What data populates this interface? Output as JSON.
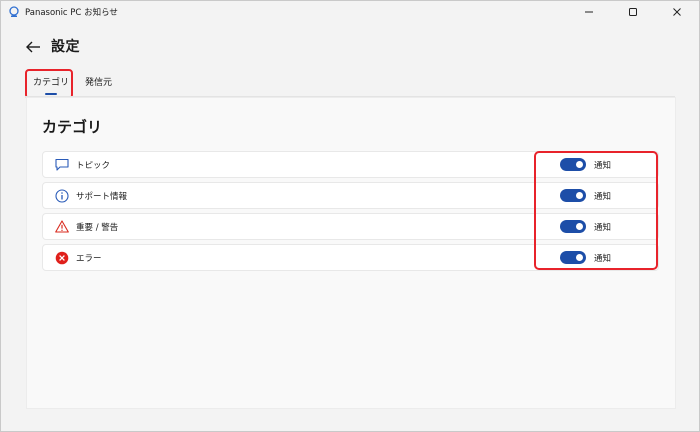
{
  "window": {
    "title": "Panasonic PC お知らせ"
  },
  "header": {
    "title": "設定"
  },
  "tabs": [
    {
      "label": "カテゴリ",
      "active": true
    },
    {
      "label": "発信元",
      "active": false
    }
  ],
  "section": {
    "title": "カテゴリ"
  },
  "categories": [
    {
      "label": "トピック",
      "icon": "chat-bubble-icon",
      "toggle_label": "通知",
      "enabled": true
    },
    {
      "label": "サポート情報",
      "icon": "info-icon",
      "toggle_label": "通知",
      "enabled": true
    },
    {
      "label": "重要 / 警告",
      "icon": "warning-icon",
      "toggle_label": "通知",
      "enabled": true
    },
    {
      "label": "エラー",
      "icon": "error-icon",
      "toggle_label": "通知",
      "enabled": true
    }
  ],
  "colors": {
    "accent": "#1d4ea8",
    "highlight": "#e8232b",
    "error": "#e0201b",
    "warning": "#d92a1e"
  }
}
